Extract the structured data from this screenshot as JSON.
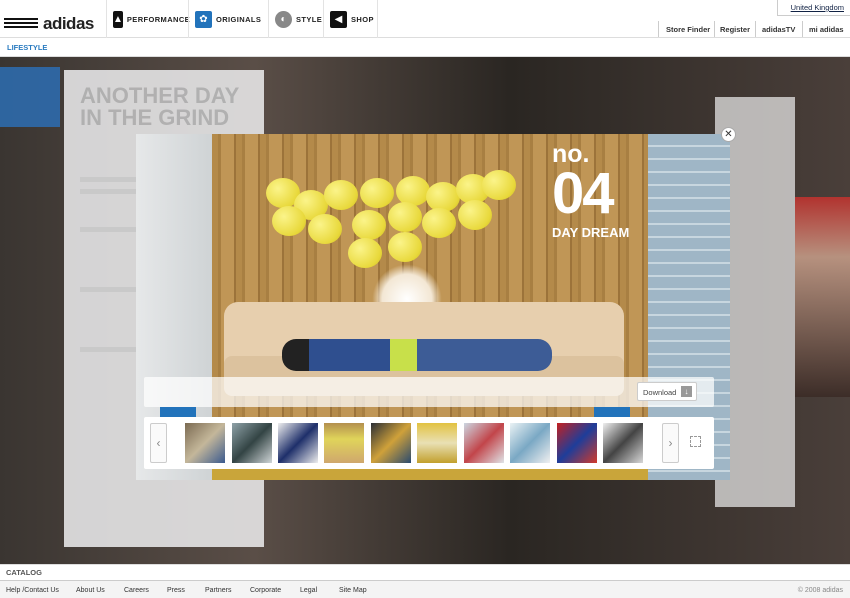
{
  "brand": {
    "name": "adidas"
  },
  "nav": {
    "items": [
      {
        "label": "PERFORMANCE",
        "icon": "performance-logo-icon"
      },
      {
        "label": "ORIGINALS",
        "icon": "trefoil-icon"
      },
      {
        "label": "STYLE",
        "icon": "style-icon"
      },
      {
        "label": "SHOP",
        "icon": "shop-icon"
      }
    ]
  },
  "country": "United Kingdom",
  "utility_links": [
    "Store Finder",
    "Register",
    "adidasTV",
    "mi adidas"
  ],
  "subnav": {
    "label": "LIFESTYLE"
  },
  "background_page": {
    "heading_line1": "ANOTHER DAY",
    "heading_line2": "IN THE GRIND"
  },
  "lightbox": {
    "number_prefix": "no.",
    "number": "04",
    "caption": "DAY DREAM",
    "download_label": "Download",
    "close_icon": "close-icon",
    "thumbnail_count": 10,
    "selected_thumbnail": 4
  },
  "catalog_label": "CATALOG",
  "footer": {
    "links": [
      "Help /Contact Us",
      "About Us",
      "Careers",
      "Press",
      "Partners",
      "Corporate",
      "Legal",
      "Site Map"
    ],
    "copyright": "© 2008 adidas"
  },
  "colors": {
    "accent_blue": "#2a7bc0",
    "brand_blue": "#2273bb"
  }
}
